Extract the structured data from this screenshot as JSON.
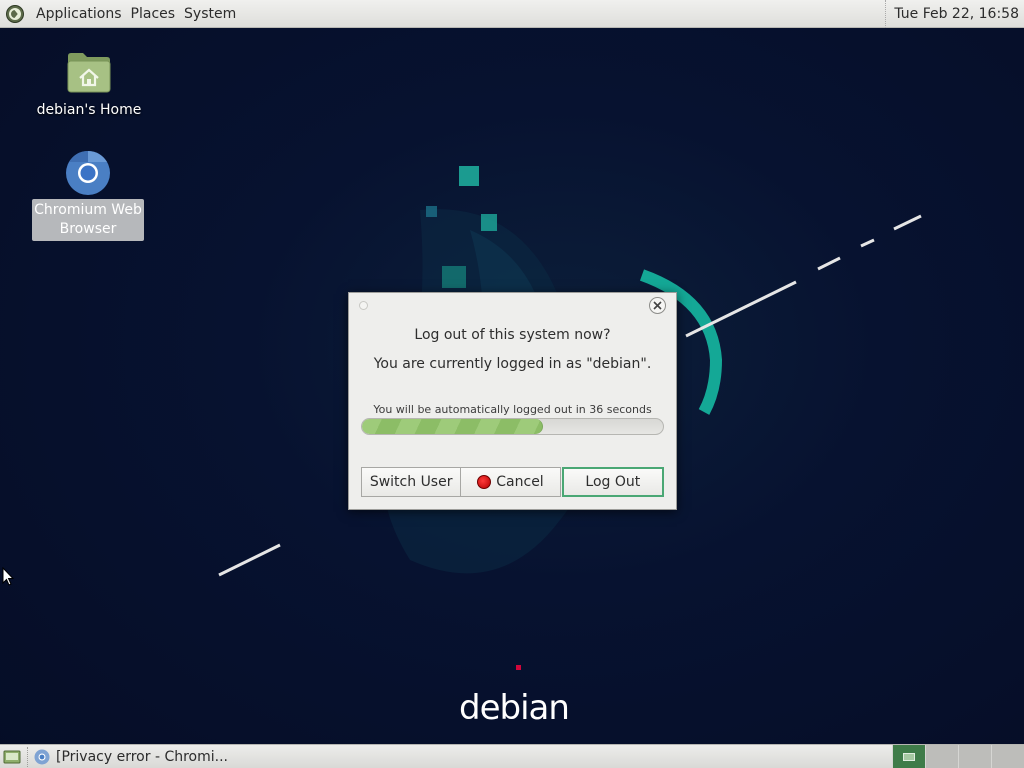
{
  "top_panel": {
    "menus": [
      "Applications",
      "Places",
      "System"
    ],
    "clock": "Tue Feb 22, 16:58"
  },
  "desktop": {
    "icons": [
      {
        "label": "debian's Home",
        "icon": "home-folder-icon",
        "selected": false
      },
      {
        "label": "Chromium Web Browser",
        "icon": "chromium-icon",
        "selected": true
      }
    ],
    "wallpaper_brand": "debian",
    "colors": {
      "accent_teal": "#1fb3a1",
      "background": "#050d26",
      "debian_red": "#d0073b"
    }
  },
  "logout_dialog": {
    "title": "Log out of this system now?",
    "subtitle": "You are currently logged in as \"debian\".",
    "countdown": "You will be automatically logged out in 36 seconds",
    "progress_fraction": 0.6,
    "buttons": {
      "switch_user": "Switch User",
      "cancel": "Cancel",
      "log_out": "Log Out"
    },
    "default_button": "log_out"
  },
  "bottom_panel": {
    "tasks": [
      {
        "label": "[Privacy error - Chromi...",
        "icon": "chromium-icon"
      }
    ],
    "workspaces": 4,
    "active_workspace": 1
  }
}
